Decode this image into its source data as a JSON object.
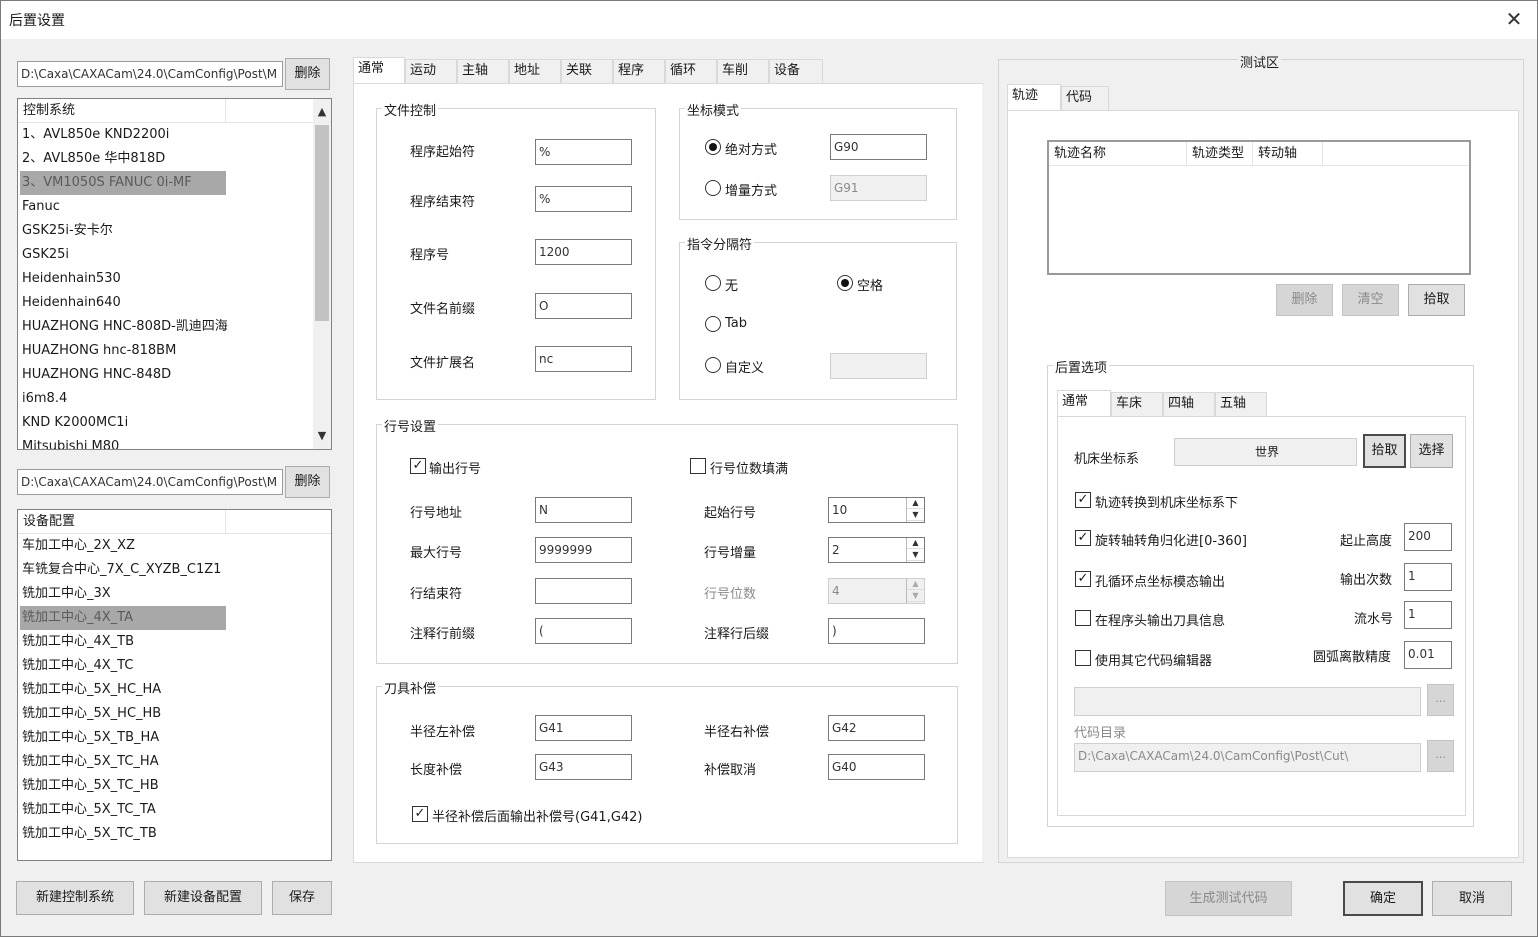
{
  "window": {
    "title": "后置设置",
    "close": "✕"
  },
  "left": {
    "path1": "D:\\Caxa\\CAXACam\\24.0\\CamConfig\\Post\\M",
    "delete1": "删除",
    "control_header": "控制系统",
    "control_items": [
      "1、AVL850e KND2200i",
      "2、AVL850e 华中818D",
      "3、VM1050S FANUC 0i-MF",
      "Fanuc",
      "GSK25i-安卡尔",
      "GSK25i",
      "Heidenhain530",
      "Heidenhain640",
      "HUAZHONG HNC-808D-凯迪四海",
      "HUAZHONG hnc-818BM",
      "HUAZHONG HNC-848D",
      "i6m8.4",
      "KND K2000MC1i",
      "Mitsubishi M80"
    ],
    "path2": "D:\\Caxa\\CAXACam\\24.0\\CamConfig\\Post\\M",
    "delete2": "删除",
    "device_header": "设备配置",
    "device_items": [
      "车加工中心_2X_XZ",
      "车铣复合中心_7X_C_XYZB_C1Z1",
      "铣加工中心_3X",
      "铣加工中心_4X_TA",
      "铣加工中心_4X_TB",
      "铣加工中心_4X_TC",
      "铣加工中心_5X_HC_HA",
      "铣加工中心_5X_HC_HB",
      "铣加工中心_5X_TB_HA",
      "铣加工中心_5X_TC_HA",
      "铣加工中心_5X_TC_HB",
      "铣加工中心_5X_TC_TA",
      "铣加工中心_5X_TC_TB"
    ],
    "btn_new_control": "新建控制系统",
    "btn_new_device": "新建设备配置",
    "btn_save": "保存"
  },
  "center": {
    "tabs": [
      "通常",
      "运动",
      "主轴",
      "地址",
      "关联",
      "程序",
      "循环",
      "车削",
      "设备"
    ],
    "file_ctrl": {
      "title": "文件控制",
      "start_label": "程序起始符",
      "start_val": "%",
      "end_label": "程序结束符",
      "end_val": "%",
      "num_label": "程序号",
      "num_val": "1200",
      "prefix_label": "文件名前缀",
      "prefix_val": "O",
      "ext_label": "文件扩展名",
      "ext_val": "nc"
    },
    "coord": {
      "title": "坐标模式",
      "abs_label": "绝对方式",
      "abs_val": "G90",
      "inc_label": "增量方式",
      "inc_val": "G91"
    },
    "sep": {
      "title": "指令分隔符",
      "none": "无",
      "space": "空格",
      "tab": "Tab",
      "custom": "自定义",
      "custom_val": ""
    },
    "line": {
      "title": "行号设置",
      "output": "输出行号",
      "fill": "行号位数填满",
      "addr_label": "行号地址",
      "addr_val": "N",
      "start_label": "起始行号",
      "start_val": "10",
      "max_label": "最大行号",
      "max_val": "9999999",
      "inc_label": "行号增量",
      "inc_val": "2",
      "end_label": "行结束符",
      "end_val": "",
      "digits_label": "行号位数",
      "digits_val": "4",
      "cpre_label": "注释行前缀",
      "cpre_val": "(",
      "csuf_label": "注释行后缀",
      "csuf_val": ")"
    },
    "tool": {
      "title": "刀具补偿",
      "left_label": "半径左补偿",
      "left_val": "G41",
      "right_label": "半径右补偿",
      "right_val": "G42",
      "len_label": "长度补偿",
      "len_val": "G43",
      "cancel_label": "补偿取消",
      "cancel_val": "G40",
      "out_label": "半径补偿后面输出补偿号(G41,G42)"
    }
  },
  "right": {
    "title": "测试区",
    "tabs": [
      "轨迹",
      "代码"
    ],
    "cols": [
      "轨迹名称",
      "轨迹类型",
      "转动轴"
    ],
    "btn_delete": "删除",
    "btn_clear": "清空",
    "btn_pick": "拾取",
    "post_title": "后置选项",
    "post_tabs": [
      "通常",
      "车床",
      "四轴",
      "五轴"
    ],
    "mcs_label": "机床坐标系",
    "mcs_val": "世界",
    "btn_pick2": "拾取",
    "btn_select": "选择",
    "chk1": "轨迹转换到机床坐标系下",
    "chk2": "旋转轴转角归化进[0-360]",
    "chk3": "孔循环点坐标模态输出",
    "chk4": "在程序头输出刀具信息",
    "chk5": "使用其它代码编辑器",
    "h_label": "起止高度",
    "h_val": "200",
    "n_label": "输出次数",
    "n_val": "1",
    "s_label": "流水号",
    "s_val": "1",
    "arc_label": "圆弧离散精度",
    "arc_val": "0.01",
    "editor_val": "",
    "dir_label": "代码目录",
    "dir_val": "D:\\Caxa\\CAXACam\\24.0\\CamConfig\\Post\\Cut\\",
    "ellipsis": "...",
    "btn_gen": "生成测试代码"
  },
  "footer": {
    "ok": "确定",
    "cancel": "取消"
  }
}
